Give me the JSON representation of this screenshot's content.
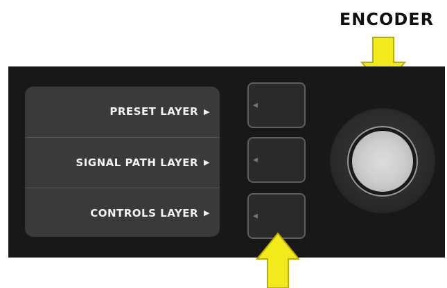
{
  "encoder_label": "ENCODER",
  "display": {
    "layers": [
      {
        "label": "PRESET LAYER",
        "arrow": "▶"
      },
      {
        "label": "SIGNAL PATH LAYER",
        "arrow": "▶"
      },
      {
        "label": "CONTROLS LAYER",
        "arrow": "▶"
      }
    ]
  },
  "soft_buttons": [
    {
      "indicator": "◀"
    },
    {
      "indicator": "◀"
    },
    {
      "indicator": "◀"
    }
  ],
  "colors": {
    "panel": "#181818",
    "display": "#3a3a3a",
    "callout_arrow": "#f3ea1c",
    "knob_cap": "#cfcfcf"
  },
  "icons": {
    "encoder_callout": "down-arrow-icon",
    "button_callout": "up-arrow-icon"
  }
}
